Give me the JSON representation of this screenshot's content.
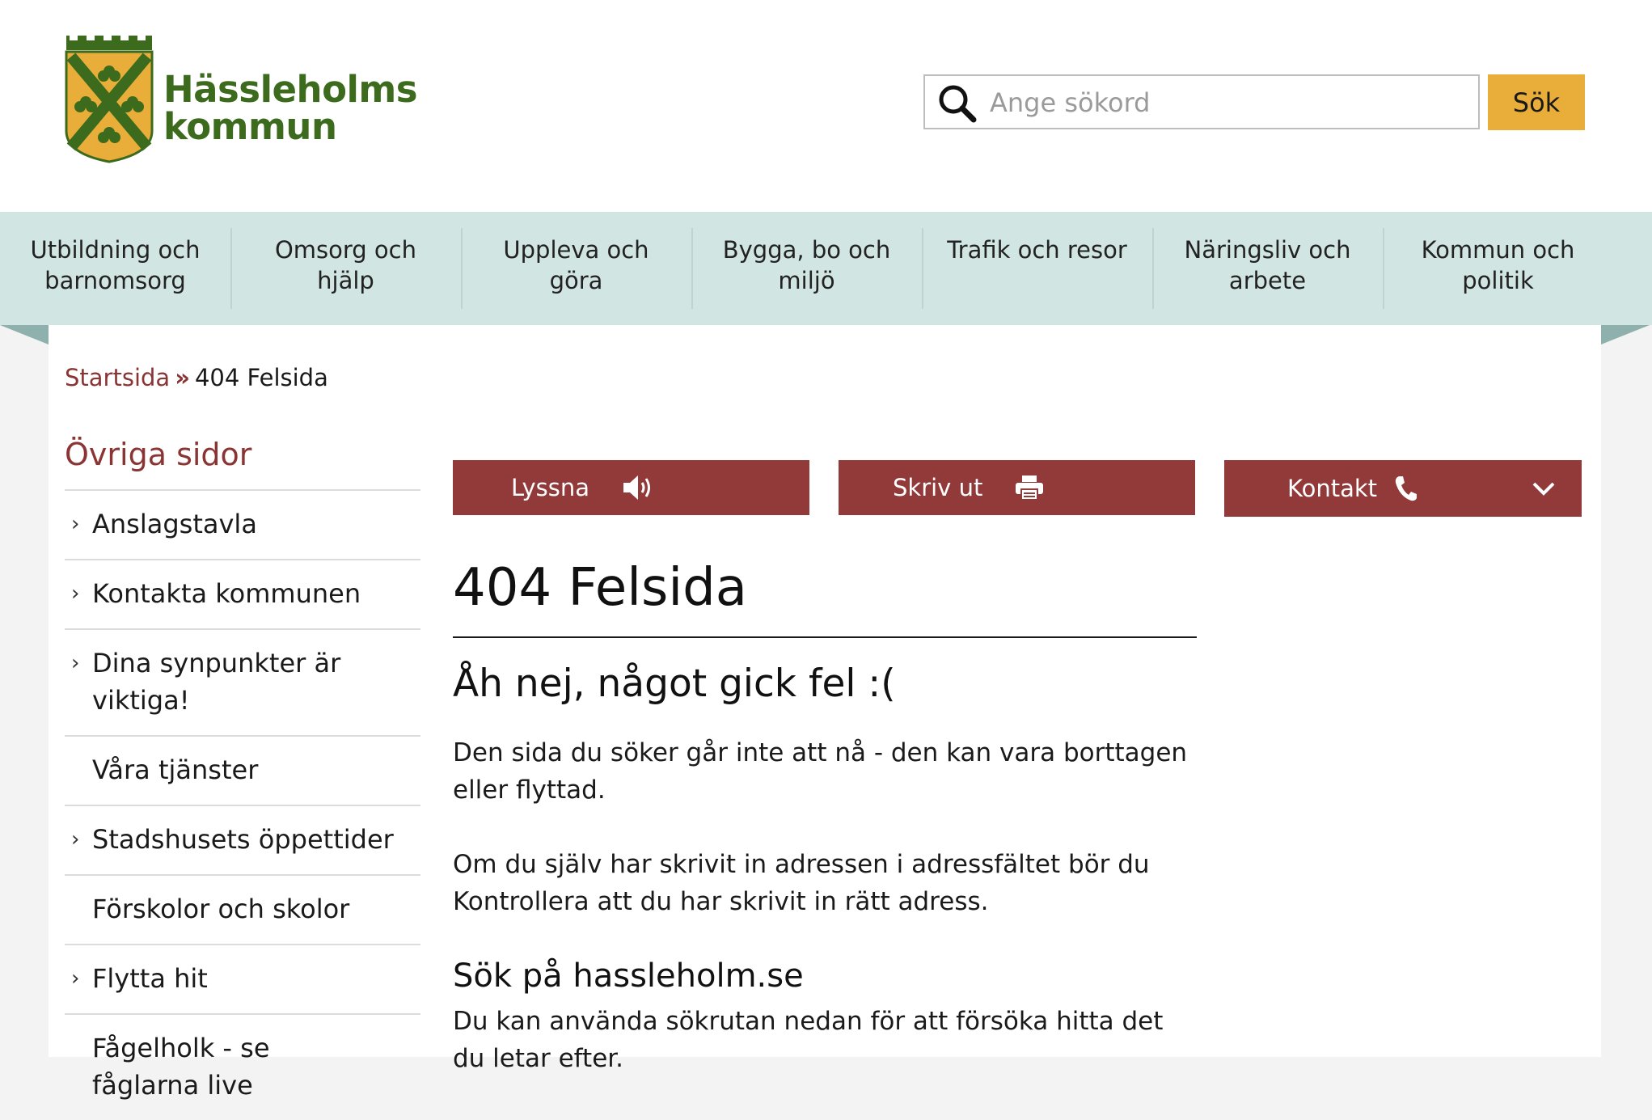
{
  "header": {
    "logo_line1": "Hässleholms",
    "logo_line2": "kommun",
    "search_placeholder": "Ange sökord",
    "search_button": "Sök"
  },
  "nav": {
    "items": [
      {
        "label": "Utbildning och barnomsorg"
      },
      {
        "label": "Omsorg och hjälp"
      },
      {
        "label": "Uppleva och göra"
      },
      {
        "label": "Bygga, bo och miljö"
      },
      {
        "label": "Trafik och resor"
      },
      {
        "label": "Näringsliv och arbete"
      },
      {
        "label": "Kommun och politik"
      }
    ]
  },
  "breadcrumb": {
    "home": "Startsida",
    "separator": "»",
    "current": "404 Felsida"
  },
  "sidebar": {
    "title": "Övriga sidor",
    "items": [
      {
        "label": "Anslagstavla",
        "has_children": true
      },
      {
        "label": "Kontakta kommunen",
        "has_children": true
      },
      {
        "label": "Dina synpunkter är viktiga!",
        "has_children": true
      },
      {
        "label": "Våra tjänster",
        "has_children": false
      },
      {
        "label": "Stadshusets öppettider",
        "has_children": true
      },
      {
        "label": "Förskolor och skolor",
        "has_children": false
      },
      {
        "label": "Flytta hit",
        "has_children": true
      },
      {
        "label": "Fågelholk - se fåglarna live",
        "has_children": false
      }
    ]
  },
  "tools": {
    "listen": "Lyssna",
    "print": "Skriv ut",
    "contact": "Kontakt"
  },
  "main": {
    "title": "404 Felsida",
    "subtitle": "Åh nej, något gick fel :(",
    "para1": "Den sida du söker går inte att nå - den kan vara borttagen eller flyttad.",
    "para2": "Om du själv har skrivit in adressen i adressfältet bör du Kontrollera att du har skrivit in rätt adress.",
    "search_heading": "Sök på hassleholm.se",
    "search_text": "Du kan använda sökrutan nedan för att försöka hitta det du letar efter."
  },
  "colors": {
    "brand_green": "#3c6b1d",
    "accent_red": "#923a3a",
    "search_button": "#e9ad3a",
    "nav_bg": "#d1e5e2"
  }
}
